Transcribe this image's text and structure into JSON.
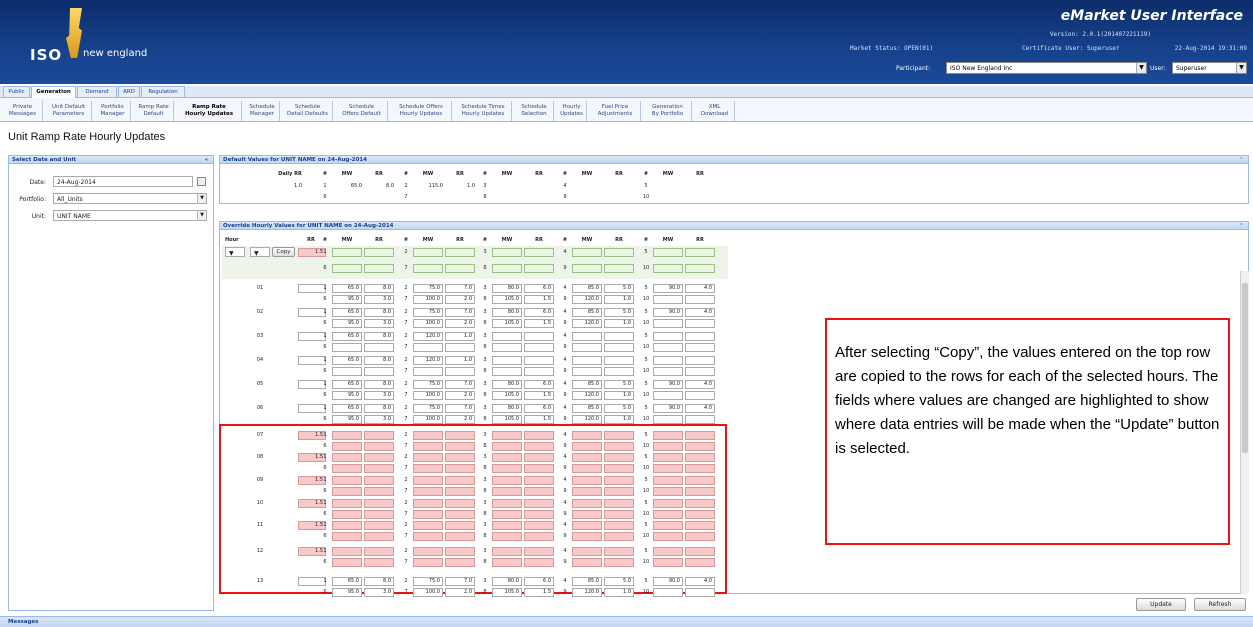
{
  "header": {
    "logo_iso": "ISO",
    "logo_ne": "new england",
    "app_title": "eMarket User Interface",
    "version": "Version: 2.0.1(201407221119)",
    "market_status": "Market Status: OPEN(01)",
    "certificate_user": "Certificate User: Superuser",
    "datetime": "22-Aug-2014 19:31:09",
    "participant_label": "Participant:",
    "participant_value": "ISO New England Inc",
    "user_label": "User:",
    "user_value": "Superuser"
  },
  "tabs": [
    "Public",
    "Generation",
    "Demand",
    "ARD",
    "Regulation"
  ],
  "subnav": [
    [
      "Private",
      "Messages"
    ],
    [
      "Unit Default",
      "Parameters"
    ],
    [
      "Portfolio",
      "Manager"
    ],
    [
      "Ramp Rate",
      "Default"
    ],
    [
      "Ramp Rate",
      "Hourly Updates"
    ],
    [
      "Schedule",
      "Manager"
    ],
    [
      "Schedule",
      "Detail Defaults"
    ],
    [
      "Schedule",
      "Offers Default"
    ],
    [
      "Schedule Offers",
      "Hourly Updates"
    ],
    [
      "Schedule Times",
      "Hourly Updates"
    ],
    [
      "Schedule",
      "Selection"
    ],
    [
      "Hourly",
      "Updates"
    ],
    [
      "Fuel Price",
      "Adjustments"
    ],
    [
      "Generation",
      "By Portfolio"
    ],
    [
      "XML",
      "Download"
    ]
  ],
  "page_title": "Unit Ramp Rate Hourly Updates",
  "left_panel": {
    "title": "Select Date and Unit",
    "date_label": "Date:",
    "date_value": "24-Aug-2014",
    "portfolio_label": "Portfolio:",
    "portfolio_value": "All_Units",
    "unit_label": "Unit:",
    "unit_value": "UNIT NAME"
  },
  "defaults_panel": {
    "title": "Default Values for UNIT NAME on 24-Aug-2014",
    "daily_rr_label": "Daily RR",
    "daily_rr_value": "1.0",
    "row1": [
      "65.0",
      "8.0",
      "115.0",
      "1.0"
    ],
    "segments_row1": [
      "1",
      "2",
      "3",
      "4",
      "5"
    ],
    "segments_row2": [
      "6",
      "7",
      "8",
      "9",
      "10"
    ]
  },
  "override_panel": {
    "title": "Override Hourly Values for UNIT NAME on 24-Aug-2014",
    "hour_header": "Hour",
    "copy_button": "Copy",
    "copy_rr": "1.5",
    "col_headers": [
      "RR",
      "#",
      "MW",
      "RR",
      "#",
      "MW",
      "RR",
      "#",
      "MW",
      "RR",
      "#",
      "MW",
      "RR",
      "#",
      "MW",
      "RR"
    ],
    "hours": [
      "01",
      "02",
      "03",
      "04",
      "05",
      "06",
      "07",
      "08",
      "09",
      "10",
      "11",
      "12",
      "13"
    ],
    "highlight_rr": "1.5",
    "full_row_a": [
      "65.0",
      "8.0",
      "75.0",
      "7.0",
      "80.0",
      "6.0",
      "85.0",
      "5.0",
      "90.0",
      "4.0"
    ],
    "full_row_b": [
      "95.0",
      "3.0",
      "100.0",
      "2.0",
      "105.0",
      "1.5",
      "120.0",
      "1.0"
    ],
    "short_row_a": [
      "65.0",
      "8.0",
      "120.0",
      "1.0"
    ],
    "short_row_a2": [
      "65.0",
      "8.0",
      "75.0",
      "7.0",
      "80.0",
      "6.0",
      "85.0",
      "5.0",
      "90.0",
      "4.0"
    ]
  },
  "buttons": {
    "update": "Update",
    "refresh": "Refresh"
  },
  "messages_label": "Messages",
  "callout_text": "After selecting “Copy”, the values entered on the top row are copied to the rows for each of the selected hours. The fields where values are changed are highlighted to show where data entries will be made when the “Update” button is selected."
}
